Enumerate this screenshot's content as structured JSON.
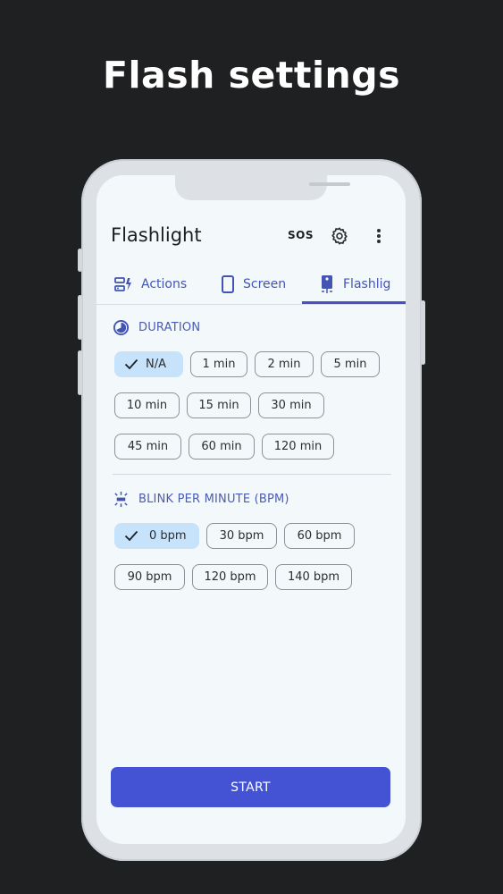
{
  "headline": "Flash settings",
  "app": {
    "title": "Flashlight",
    "sos_label": "SOS"
  },
  "tabs": [
    {
      "label": "Actions",
      "icon": "actions-icon"
    },
    {
      "label": "Screen",
      "icon": "phone-screen-icon"
    },
    {
      "label": "Flashlig",
      "icon": "phone-flashlight-icon",
      "selected": true
    }
  ],
  "duration": {
    "title": "DURATION",
    "icon": "timer-icon",
    "options": [
      "N/A",
      "1 min",
      "2 min",
      "5 min",
      "10 min",
      "15 min",
      "30 min",
      "45 min",
      "60 min",
      "120 min"
    ],
    "selected": "N/A"
  },
  "blink": {
    "title": "BLINK PER MINUTE (BPM)",
    "icon": "blink-icon",
    "options": [
      "0 bpm",
      "30 bpm",
      "60 bpm",
      "90 bpm",
      "120 bpm",
      "140 bpm"
    ],
    "selected": "0 bpm"
  },
  "start_label": "START",
  "colors": {
    "accent": "#4453d4",
    "selected_chip": "#c6e3fb",
    "background": "#1f2021"
  }
}
